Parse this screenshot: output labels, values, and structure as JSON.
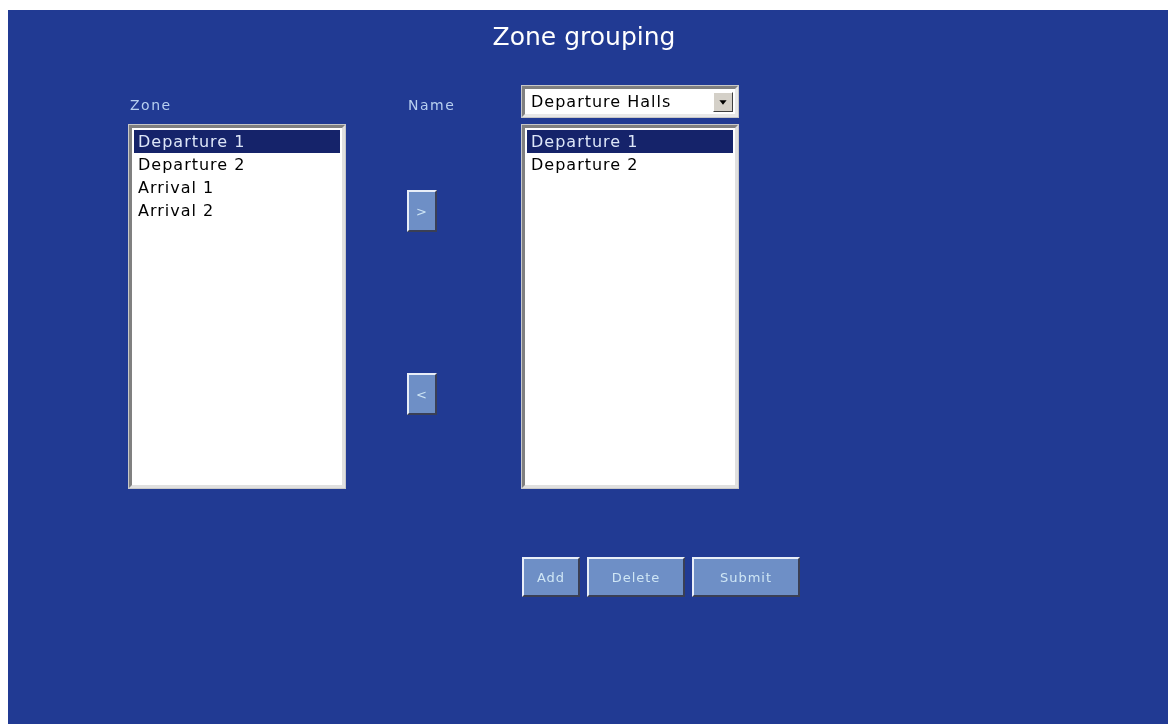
{
  "title": "Zone grouping",
  "zone_list": {
    "label": "Zone",
    "items": [
      {
        "text": "Departure 1",
        "selected": true
      },
      {
        "text": "Departure 2",
        "selected": false
      },
      {
        "text": "Arrival 1",
        "selected": false
      },
      {
        "text": "Arrival 2",
        "selected": false
      }
    ]
  },
  "name_field": {
    "label": "Name",
    "value": "Departure Halls"
  },
  "move_buttons": [
    ">",
    "<"
  ],
  "group_list": {
    "items": [
      {
        "text": "Departure 1",
        "selected": true
      },
      {
        "text": "Departure 2",
        "selected": false
      }
    ]
  },
  "buttons": [
    "Add",
    "Delete",
    "Submit"
  ]
}
